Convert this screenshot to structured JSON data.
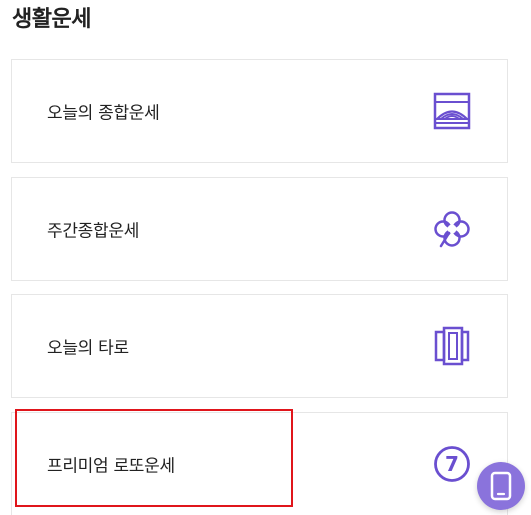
{
  "section": {
    "title": "생활운세"
  },
  "cards": [
    {
      "label": "오늘의 종합운세",
      "icon": "sunrise-frame-icon"
    },
    {
      "label": "주간종합운세",
      "icon": "clover-icon"
    },
    {
      "label": "오늘의 타로",
      "icon": "tarot-cards-icon"
    },
    {
      "label": "프리미엄 로또운세",
      "icon": "lotto-ball-icon",
      "badge": "7"
    }
  ],
  "fab": {
    "icon": "smartphone-icon"
  },
  "colors": {
    "accent": "#6a4fd0",
    "highlight": "#e0151b",
    "fab": "#8a73dc"
  }
}
